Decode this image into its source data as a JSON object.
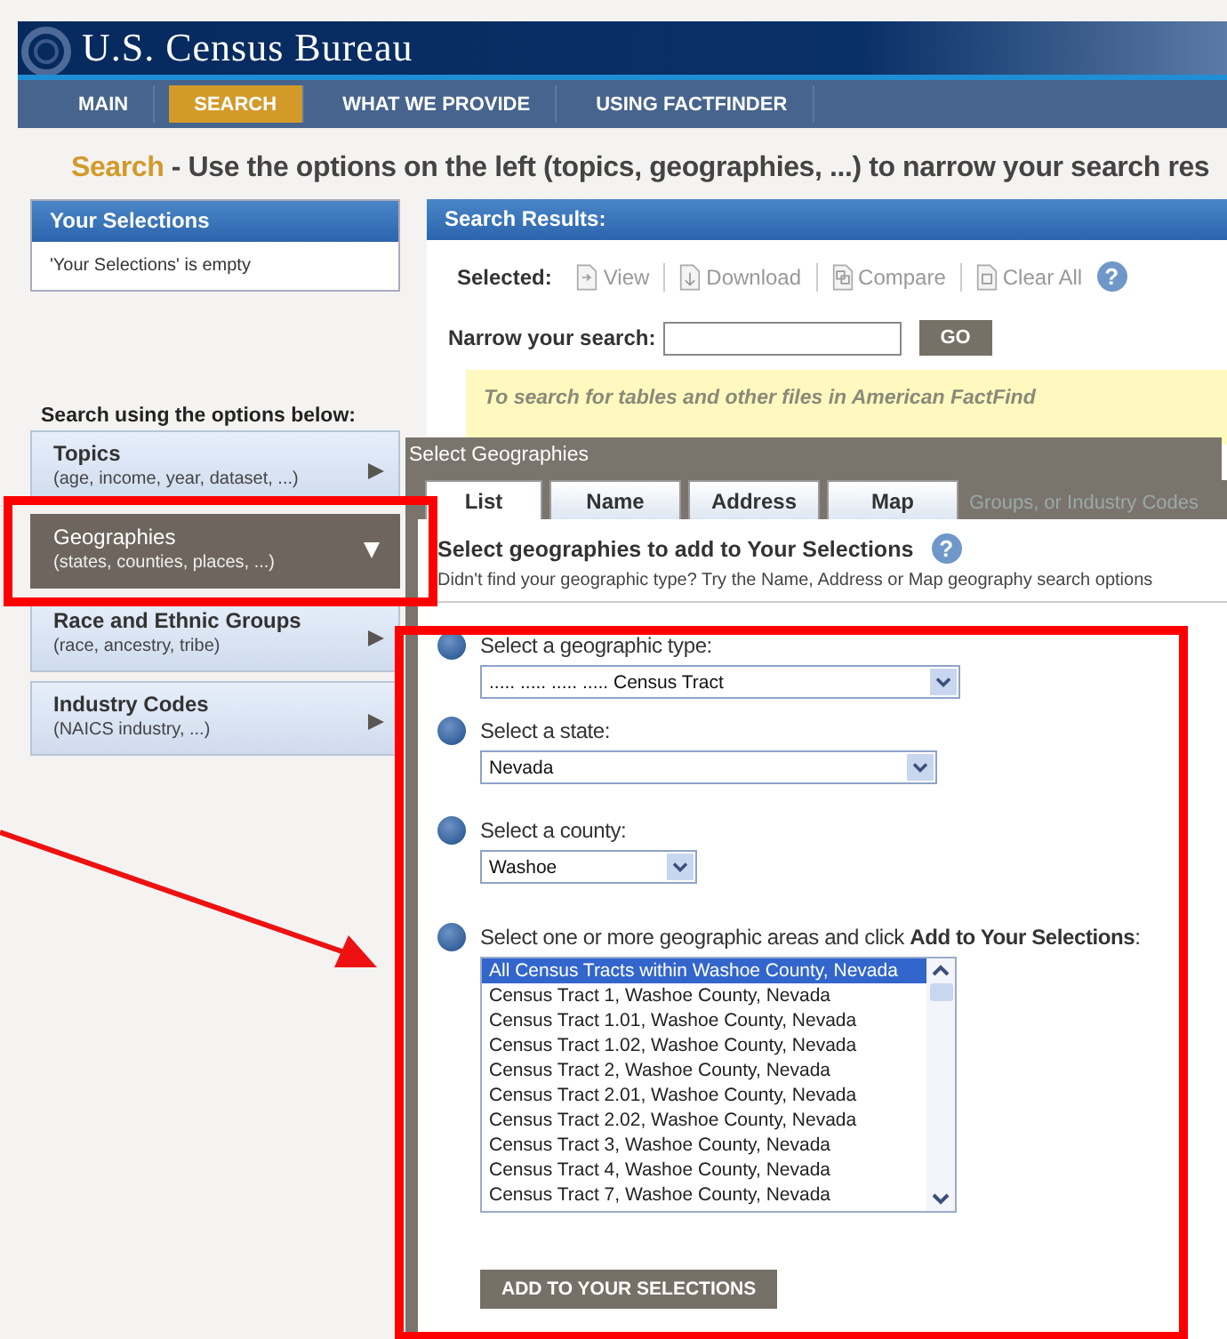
{
  "header": {
    "title": "U.S. Census Bureau"
  },
  "nav": [
    {
      "label": "MAIN",
      "selected": false
    },
    {
      "label": "SEARCH",
      "selected": true
    },
    {
      "label": "WHAT WE PROVIDE",
      "selected": false
    },
    {
      "label": "USING FACTFINDER",
      "selected": false
    }
  ],
  "page_heading": {
    "lead": "Search",
    "text": "- Use the options on the left (topics, geographies, ...) to narrow your search res"
  },
  "your_selections": {
    "title": "Your Selections",
    "empty_text": "'Your Selections' is empty"
  },
  "options_heading": "Search using the options below:",
  "options": [
    {
      "title": "Topics",
      "subtitle": "(age, income, year, dataset, ...)",
      "selected": false
    },
    {
      "title": "Geographies",
      "subtitle": "(states, counties, places, ...)",
      "selected": true
    },
    {
      "title": "Race and Ethnic Groups",
      "subtitle": "(race, ancestry, tribe)",
      "selected": false
    },
    {
      "title": "Industry Codes",
      "subtitle": "(NAICS industry, ...)",
      "selected": false
    }
  ],
  "search_results": {
    "title": "Search Results:",
    "selected_label": "Selected:",
    "actions": [
      "View",
      "Download",
      "Compare",
      "Clear All"
    ],
    "help": "?",
    "narrow_label": "Narrow your search:",
    "go": "GO",
    "hint": "To search for tables and other files in American FactFind"
  },
  "popup": {
    "title": "Select Geographies",
    "tabs": [
      {
        "label": "List",
        "selected": true
      },
      {
        "label": "Name",
        "selected": false
      },
      {
        "label": "Address",
        "selected": false
      },
      {
        "label": "Map",
        "selected": false
      }
    ],
    "behind_text": "Groups, or Industry Codes",
    "heading": "Select geographies to add to Your Selections",
    "help": "?",
    "note": "Didn't find your geographic type? Try the Name, Address or Map geography search options",
    "steps": [
      {
        "kind": "dropdown",
        "label": "Select a geographic type:",
        "value": "..... ..... ..... ..... Census Tract"
      },
      {
        "kind": "dropdown",
        "label": "Select a state:",
        "value": "Nevada"
      },
      {
        "kind": "dropdown",
        "label": "Select a county:",
        "value": "Washoe"
      },
      {
        "kind": "listbox",
        "label": "Select one or more geographic areas and click **Add to Your Selections**:",
        "items": [
          {
            "text": "All Census Tracts within Washoe County, Nevada",
            "selected": true
          },
          {
            "text": "Census Tract 1, Washoe County, Nevada",
            "selected": false
          },
          {
            "text": "Census Tract 1.01, Washoe County, Nevada",
            "selected": false
          },
          {
            "text": "Census Tract 1.02, Washoe County, Nevada",
            "selected": false
          },
          {
            "text": "Census Tract 2, Washoe County, Nevada",
            "selected": false
          },
          {
            "text": "Census Tract 2.01, Washoe County, Nevada",
            "selected": false
          },
          {
            "text": "Census Tract 2.02, Washoe County, Nevada",
            "selected": false
          },
          {
            "text": "Census Tract 3, Washoe County, Nevada",
            "selected": false
          },
          {
            "text": "Census Tract 4, Washoe County, Nevada",
            "selected": false
          },
          {
            "text": "Census Tract 7, Washoe County, Nevada",
            "selected": false
          }
        ]
      }
    ],
    "add_button": "ADD TO YOUR SELECTIONS"
  }
}
